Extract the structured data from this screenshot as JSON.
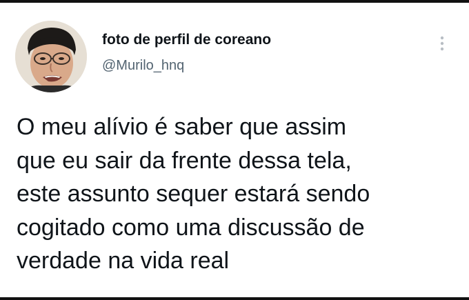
{
  "tweet": {
    "author": {
      "display_name": "foto de perfil de coreano",
      "handle": "@Murilo_hnq",
      "avatar_icon": "profile-photo"
    },
    "menu_icon": "more-options-icon",
    "text_lines": [
      "O meu alívio é saber que assim",
      "que eu sair da frente dessa tela,",
      "este assunto sequer estará sendo",
      "cogitado como uma discussão de",
      "verdade na vida real"
    ]
  },
  "colors": {
    "text_primary": "#0f1419",
    "text_secondary": "#536471",
    "border": "#111111",
    "background": "#ffffff"
  }
}
